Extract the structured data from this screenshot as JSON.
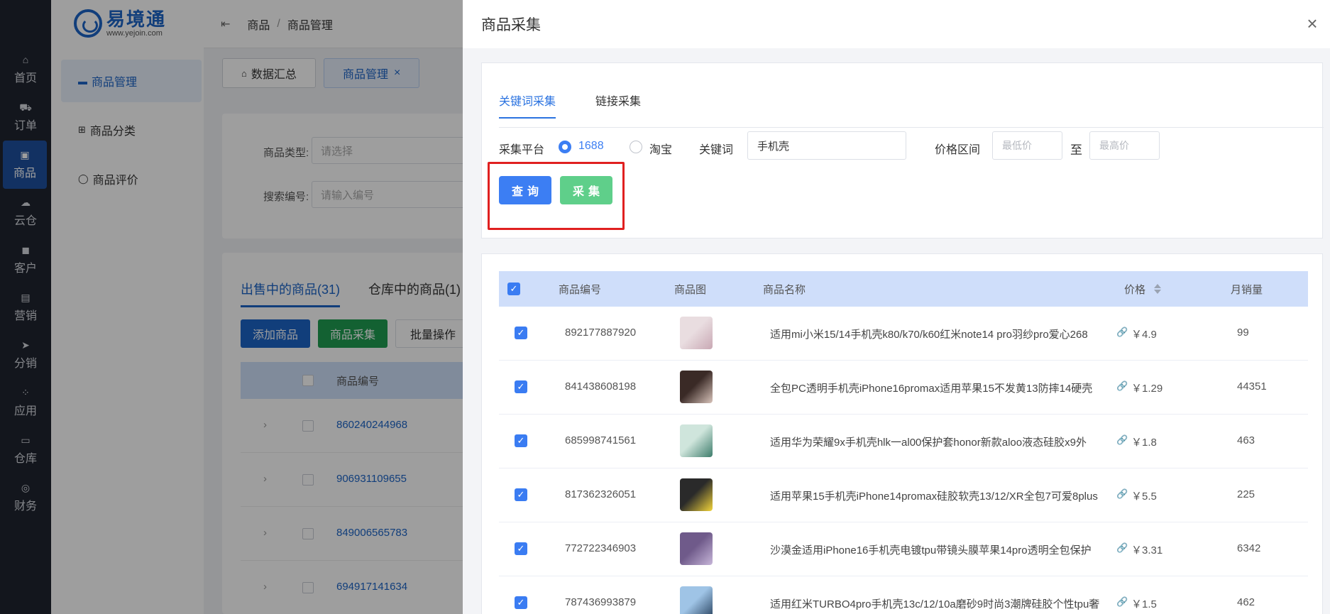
{
  "leftnav": {
    "items": [
      {
        "label": "首页",
        "icon": "home-icon",
        "glyph": "⌂"
      },
      {
        "label": "订单",
        "icon": "cart-icon",
        "glyph": "⛟"
      },
      {
        "label": "商品",
        "icon": "bag-icon",
        "glyph": "▣"
      },
      {
        "label": "云仓",
        "icon": "cloud-icon",
        "glyph": "☁"
      },
      {
        "label": "客户",
        "icon": "user-icon",
        "glyph": "◼"
      },
      {
        "label": "营销",
        "icon": "gift-icon",
        "glyph": "▤"
      },
      {
        "label": "分销",
        "icon": "send-icon",
        "glyph": "➤"
      },
      {
        "label": "应用",
        "icon": "apps-icon",
        "glyph": "⁘"
      },
      {
        "label": "仓库",
        "icon": "warehouse-icon",
        "glyph": "▭"
      },
      {
        "label": "财务",
        "icon": "finance-icon",
        "glyph": "◎"
      }
    ]
  },
  "logo": {
    "name": "易境通",
    "url": "www.yejoin.com"
  },
  "subnav": {
    "items": [
      {
        "label": "商品管理",
        "glyph": "▬"
      },
      {
        "label": "商品分类",
        "glyph": "⊞"
      },
      {
        "label": "商品评价",
        "glyph": "◯"
      }
    ]
  },
  "topbar": {
    "collapse": "⇤",
    "crumb1": "商品",
    "sep": "/",
    "crumb2": "商品管理"
  },
  "pagetabs": {
    "summary": "数据汇总",
    "manage": "商品管理",
    "close": "×"
  },
  "filter": {
    "type_label": "商品类型:",
    "type_placeholder": "请选择",
    "code_label": "搜索编号:",
    "code_placeholder": "请输入编号"
  },
  "list": {
    "tab_selling": "出售中的商品(31)",
    "tab_warehouse": "仓库中的商品(1)",
    "add_btn": "添加商品",
    "collect_btn": "商品采集",
    "batch_btn": "批量操作",
    "col_code": "商品编号",
    "rows": [
      "860240244968",
      "906931109655",
      "849006565783",
      "694917141634"
    ]
  },
  "drawer": {
    "title": "商品采集",
    "close": "×",
    "tab_keyword": "关键词采集",
    "tab_link": "链接采集",
    "platform_label": "采集平台",
    "opt_1688": "1688",
    "opt_taobao": "淘宝",
    "keyword_label": "关键词",
    "keyword_value": "手机壳",
    "price_label": "价格区间",
    "min_placeholder": "最低价",
    "to": "至",
    "max_placeholder": "最高价",
    "query_btn": "查询",
    "collect_btn": "采集",
    "colors": {
      "primary": "#3c7ef3",
      "success": "#5fcf8a",
      "highlight": "#e02020"
    }
  },
  "table": {
    "headers": {
      "code": "商品编号",
      "image": "商品图",
      "name": "商品名称",
      "price": "价格",
      "sales": "月销量"
    },
    "rows": [
      {
        "code": "892177887920",
        "name": "适用mi小米15/14手机壳k80/k70/k60红米note14 pro羽纱pro爱心268",
        "price": "￥4.9",
        "sales": "99",
        "thumb": [
          "#e9dde0",
          "#c9a8b4"
        ]
      },
      {
        "code": "841438608198",
        "name": "全包PC透明手机壳iPhone16promax适用苹果15不发黄13防摔14硬壳",
        "price": "￥1.29",
        "sales": "44351",
        "thumb": [
          "#3a2a26",
          "#d9c4bb"
        ]
      },
      {
        "code": "685998741561",
        "name": "适用华为荣耀9x手机壳hlk一al00保护套honor新款aloo液态硅胶x9外",
        "price": "￥1.8",
        "sales": "463",
        "thumb": [
          "#cfe5dc",
          "#3e7d6c"
        ]
      },
      {
        "code": "817362326051",
        "name": "适用苹果15手机壳iPhone14promax硅胶软壳13/12/XR全包7可爱8plus",
        "price": "￥5.5",
        "sales": "225",
        "thumb": [
          "#2a2a2a",
          "#f3d53a"
        ]
      },
      {
        "code": "772722346903",
        "name": "沙漠金适用iPhone16手机壳电镀tpu带镜头膜苹果14pro透明全包保护",
        "price": "￥3.31",
        "sales": "6342",
        "thumb": [
          "#6f5a8a",
          "#c7b6d9"
        ]
      },
      {
        "code": "787436993879",
        "name": "适用红米TURBO4pro手机壳13c/12/10a磨砂9时尚3潮牌硅胶个性tpu奢",
        "price": "￥1.5",
        "sales": "462",
        "thumb": [
          "#9fc4e6",
          "#27415e"
        ]
      }
    ]
  }
}
